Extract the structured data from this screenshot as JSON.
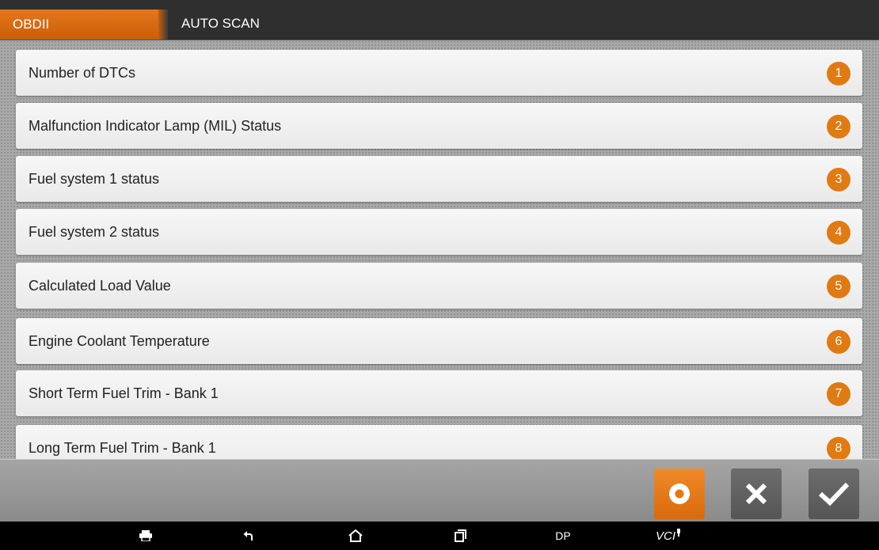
{
  "header": {
    "module_tab": "OBDII",
    "breadcrumb": "AUTO SCAN"
  },
  "items": [
    {
      "label": "Number of DTCs",
      "number": "1"
    },
    {
      "label": "Malfunction Indicator Lamp (MIL) Status",
      "number": "2"
    },
    {
      "label": "Fuel system 1 status",
      "number": "3"
    },
    {
      "label": "Fuel system 2 status",
      "number": "4"
    },
    {
      "label": "Calculated Load Value",
      "number": "5"
    },
    {
      "label": "Engine Coolant Temperature",
      "number": "6"
    },
    {
      "label": "Short Term Fuel Trim - Bank 1",
      "number": "7"
    },
    {
      "label": "Long Term Fuel Trim - Bank 1",
      "number": "8"
    }
  ],
  "actions": {
    "record_icon": "record-icon",
    "cancel_icon": "close-icon",
    "ok_icon": "check-icon"
  },
  "navbar": {
    "dp_label": "DP",
    "vci_label": "VCI"
  },
  "colors": {
    "accent": "#e07a12",
    "titlebar": "#2f2f2f",
    "row_bg": "#f2f2f2"
  }
}
